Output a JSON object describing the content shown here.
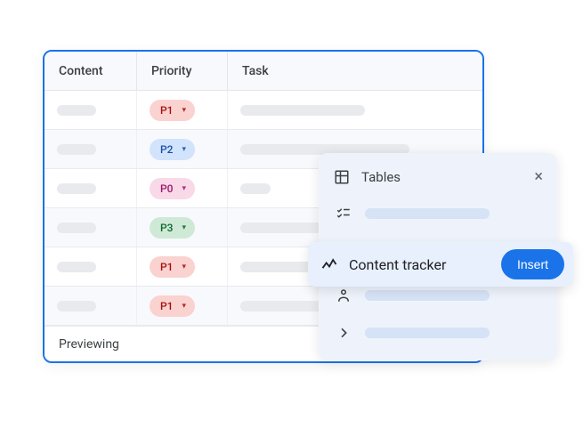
{
  "table": {
    "headers": {
      "content": "Content",
      "priority": "Priority",
      "task": "Task"
    },
    "rows": [
      {
        "priority": "P1",
        "chipClass": "chip-red",
        "taskLen": "ph-medium"
      },
      {
        "priority": "P2",
        "chipClass": "chip-blue",
        "taskLen": "ph-long"
      },
      {
        "priority": "P0",
        "chipClass": "chip-pink",
        "taskLen": "ph-xs"
      },
      {
        "priority": "P3",
        "chipClass": "chip-green",
        "taskLen": "ph-medium"
      },
      {
        "priority": "P1",
        "chipClass": "chip-red",
        "taskLen": "ph-long"
      },
      {
        "priority": "P1",
        "chipClass": "chip-red",
        "taskLen": "ph-medium"
      }
    ],
    "footer": "Previewing"
  },
  "popup": {
    "title": "Tables",
    "highlighted": {
      "label": "Content tracker",
      "button": "Insert"
    }
  }
}
